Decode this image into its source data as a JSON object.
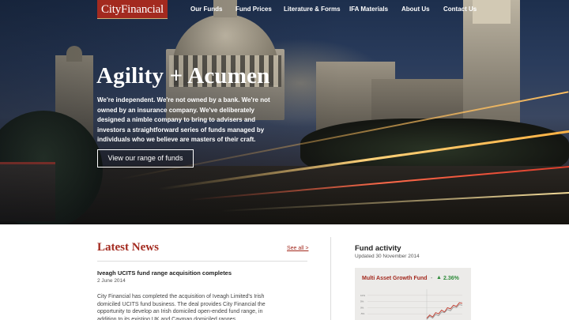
{
  "header": {
    "logo_text": "CityFinancial",
    "nav": [
      "Our Funds",
      "Fund Prices",
      "Literature & Forms",
      "IFA Materials",
      "About Us",
      "Contact Us"
    ]
  },
  "hero": {
    "title": "Agility + Acumen",
    "body": "We're independent. We're not owned by a bank. We're not owned by an insurance company. We've deliberately designed a nimble company to bring to advisers and investors a straightforward series of funds managed by individuals who we believe are masters of their craft.",
    "cta_label": "View our range of funds"
  },
  "news": {
    "section_title": "Latest News",
    "see_all_label": "See all >",
    "item": {
      "headline": "Iveagh UCITS fund range acquisition completes",
      "date": "2 June 2014",
      "body": "City Financial has completed the acquisition of Iveagh Limited's Irish domiciled UCITS fund business. The deal provides City Financial the opportunity to develop an Irish domiciled open-ended fund range, in addition to its existing UK and Cayman domiciled ranges."
    }
  },
  "fund_activity": {
    "title": "Fund activity",
    "updated": "Updated 30 November 2014",
    "fund_name": "Multi Asset Growth Fund",
    "separator": "-",
    "change": "2.36%",
    "up_color": "#2e8b3a",
    "brand_color": "#a32a1f"
  },
  "chart_data": {
    "type": "line",
    "title": "",
    "xlabel": "",
    "ylabel": "",
    "ytick_labels": [
      "10%",
      "5%",
      "0%",
      "-5%"
    ],
    "ylim": [
      -10,
      15
    ],
    "series": [
      {
        "values": [
          -8.5,
          -6,
          -7.5,
          -4,
          -5,
          -2,
          -3.5,
          0,
          -1,
          2,
          1,
          4,
          3.5
        ]
      },
      {
        "values": [
          -9.5,
          -7,
          -8.5,
          -5.5,
          -6.5,
          -3.5,
          -4,
          -1.5,
          -2.5,
          0.5,
          0,
          2.5,
          2
        ]
      }
    ]
  }
}
